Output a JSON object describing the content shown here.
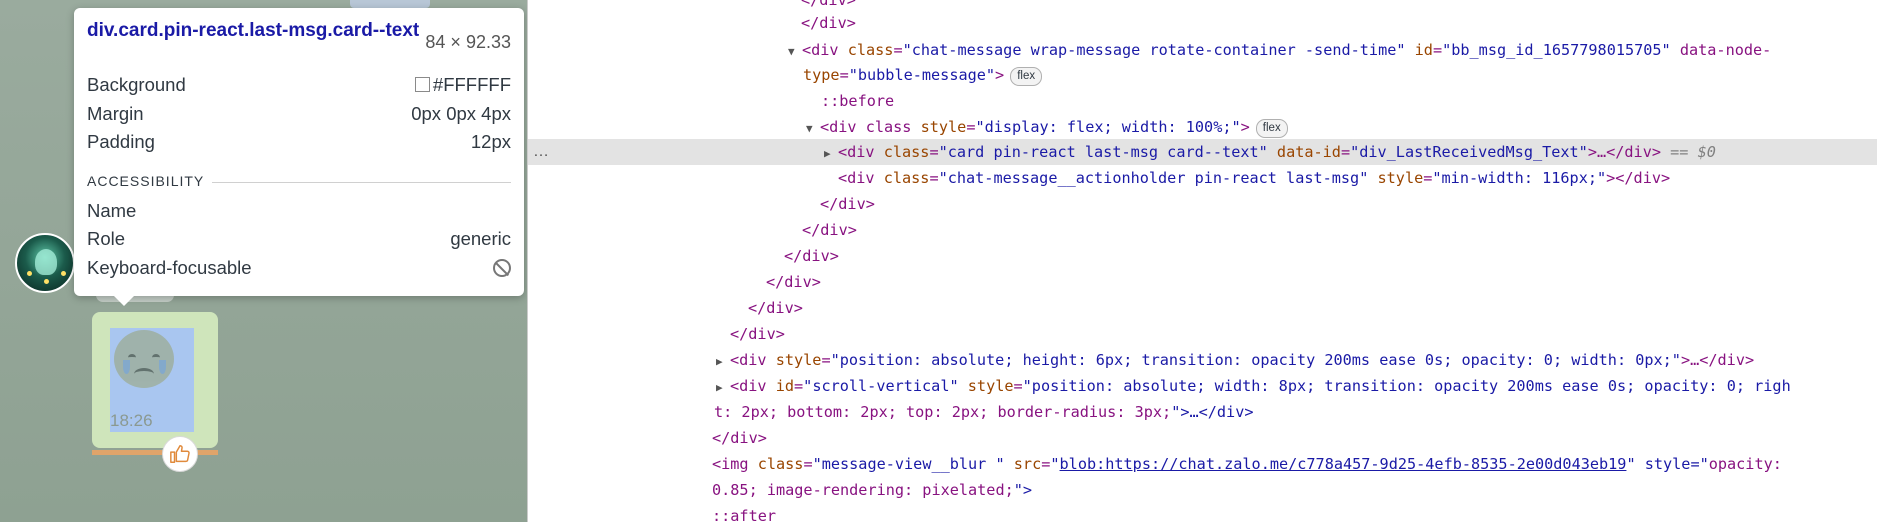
{
  "chat": {
    "message_time": "18:26",
    "colors": {
      "background": "#95a79a",
      "bubble": "#cfe5bb",
      "inspect_highlight": "#a9c6f0"
    }
  },
  "tooltip": {
    "selector": "div.card.pin-react.last-msg.card--text",
    "size": "84 × 92.33",
    "background_label": "Background",
    "background_value": "#FFFFFF",
    "margin_label": "Margin",
    "margin_value": "0px 0px 4px",
    "padding_label": "Padding",
    "padding_value": "12px",
    "accessibility_heading": "ACCESSIBILITY",
    "name_label": "Name",
    "role_label": "Role",
    "role_value": "generic",
    "focusable_label": "Keyboard-focusable",
    "focusable_icon": "not-allowed-icon"
  },
  "devtools": {
    "lines": [
      "</div>",
      "</div>",
      "<div class=\"chat-message wrap-message rotate-container  -send-time\" id=\"bb_msg_id_1657798015705\" data-node-",
      "type=\"bubble-message\">",
      "flex",
      "::before",
      "<div class style=\"display: flex; width: 100%;\">",
      "flex",
      "<div class=\"card  pin-react  last-msg card--text\" data-id=\"div_LastReceivedMsg_Text\">…</div>",
      "== $0",
      "<div class=\"chat-message__actionholder  pin-react  last-msg\" style=\"min-width: 116px;\"></div>",
      "</div>",
      "</div>",
      "</div>",
      "</div>",
      "</div>",
      "</div>",
      "<div style=\"position: absolute; height: 6px; transition: opacity 200ms ease 0s; opacity: 0; width: 0px;\">…</div>",
      "<div id=\"scroll-vertical\" style=\"position: absolute; width: 8px; transition: opacity 200ms ease 0s; opacity: 0; righ",
      "t: 2px; bottom: 2px; top: 2px; border-radius: 3px;\">…</div>",
      "</div>",
      "<img class=\"message-view__blur \" src=\"",
      "blob:https://chat.zalo.me/c778a457-9d25-4efb-8535-2e00d043eb19",
      "\" style=\"opacity:",
      "0.85; image-rendering: pixelated;\">",
      "::after"
    ],
    "more_actions": "…"
  }
}
